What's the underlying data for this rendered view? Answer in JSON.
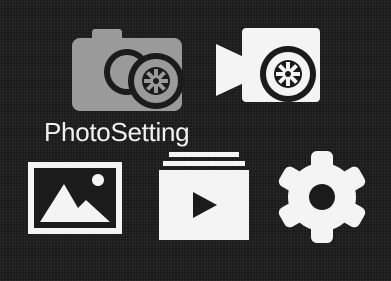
{
  "menu": {
    "items": [
      {
        "id": "photo",
        "icon": "camera-gear-icon",
        "selected": true
      },
      {
        "id": "video",
        "icon": "video-camera-gear-icon",
        "selected": false
      },
      {
        "id": "gallery",
        "icon": "picture-icon",
        "selected": false
      },
      {
        "id": "playback",
        "icon": "playback-stack-icon",
        "selected": false
      },
      {
        "id": "setup",
        "icon": "settings-gear-icon",
        "selected": false
      }
    ],
    "selected_label": "PhotoSetting"
  },
  "colors": {
    "background": "#1b1b1b",
    "icon": "#f4f4f4",
    "selected_icon": "#9a9a9a",
    "text": "#f2f2f2"
  }
}
